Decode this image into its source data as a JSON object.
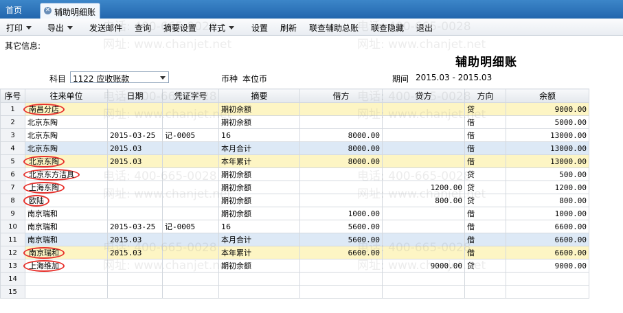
{
  "tabs": {
    "home": "首页",
    "active": "辅助明细账"
  },
  "toolbar": {
    "items": [
      "打印",
      "导出",
      "发送邮件",
      "查询",
      "摘要设置",
      "样式",
      "设置",
      "刷新",
      "联查辅助总账",
      "联查隐藏",
      "退出"
    ]
  },
  "header": {
    "other_info": "其它信息:",
    "title": "辅助明细账",
    "subject_label": "科目",
    "subject_value": "1122 应收账款",
    "currency_label": "币种",
    "currency_value": "本位币",
    "period_label": "期间",
    "period_value": "2015.03 - 2015.03"
  },
  "watermark": {
    "phone": "电话: 400-665-0028",
    "site": "网址: www.chanjet.net"
  },
  "table": {
    "columns": [
      "序号",
      "往来单位",
      "日期",
      "凭证字号",
      "摘要",
      "借方",
      "贷方",
      "方向",
      "余额"
    ],
    "rows": [
      {
        "no": "1",
        "unit": "南昌分店",
        "date": "",
        "voucher": "",
        "summary": "期初余额",
        "debit": "",
        "credit": "",
        "dir": "贷",
        "balance": "9000.00",
        "style": "yellow",
        "circled": true
      },
      {
        "no": "2",
        "unit": "北京东陶",
        "date": "",
        "voucher": "",
        "summary": "期初余额",
        "debit": "",
        "credit": "",
        "dir": "借",
        "balance": "5000.00",
        "style": "",
        "circled": false
      },
      {
        "no": "3",
        "unit": "北京东陶",
        "date": "2015-03-25",
        "voucher": "记-0005",
        "summary": "16",
        "debit": "8000.00",
        "credit": "",
        "dir": "借",
        "balance": "13000.00",
        "style": "",
        "circled": false
      },
      {
        "no": "4",
        "unit": "北京东陶",
        "date": "2015.03",
        "voucher": "",
        "summary": "本月合计",
        "debit": "8000.00",
        "credit": "",
        "dir": "借",
        "balance": "13000.00",
        "style": "blue",
        "circled": false
      },
      {
        "no": "5",
        "unit": "北京东陶",
        "date": "2015.03",
        "voucher": "",
        "summary": "本年累计",
        "debit": "8000.00",
        "credit": "",
        "dir": "借",
        "balance": "13000.00",
        "style": "yellow",
        "circled": true
      },
      {
        "no": "6",
        "unit": "北京东方洁具",
        "date": "",
        "voucher": "",
        "summary": "期初余额",
        "debit": "",
        "credit": "",
        "dir": "贷",
        "balance": "500.00",
        "style": "",
        "circled": true
      },
      {
        "no": "7",
        "unit": "上海东陶",
        "date": "",
        "voucher": "",
        "summary": "期初余额",
        "debit": "",
        "credit": "1200.00",
        "dir": "贷",
        "balance": "1200.00",
        "style": "",
        "circled": true
      },
      {
        "no": "8",
        "unit": "欧陆",
        "date": "",
        "voucher": "",
        "summary": "期初余额",
        "debit": "",
        "credit": "800.00",
        "dir": "贷",
        "balance": "800.00",
        "style": "",
        "circled": true
      },
      {
        "no": "9",
        "unit": "南京瑞和",
        "date": "",
        "voucher": "",
        "summary": "期初余额",
        "debit": "1000.00",
        "credit": "",
        "dir": "借",
        "balance": "1000.00",
        "style": "",
        "circled": false
      },
      {
        "no": "10",
        "unit": "南京瑞和",
        "date": "2015-03-25",
        "voucher": "记-0005",
        "summary": "16",
        "debit": "5600.00",
        "credit": "",
        "dir": "借",
        "balance": "6600.00",
        "style": "",
        "circled": false
      },
      {
        "no": "11",
        "unit": "南京瑞和",
        "date": "2015.03",
        "voucher": "",
        "summary": "本月合计",
        "debit": "5600.00",
        "credit": "",
        "dir": "借",
        "balance": "6600.00",
        "style": "blue",
        "circled": false
      },
      {
        "no": "12",
        "unit": "南京瑞和",
        "date": "2015.03",
        "voucher": "",
        "summary": "本年累计",
        "debit": "6600.00",
        "credit": "",
        "dir": "借",
        "balance": "6600.00",
        "style": "yellow",
        "circled": true
      },
      {
        "no": "13",
        "unit": "上海维加",
        "date": "",
        "voucher": "",
        "summary": "期初余额",
        "debit": "",
        "credit": "9000.00",
        "dir": "贷",
        "balance": "9000.00",
        "style": "",
        "circled": true
      },
      {
        "no": "14",
        "unit": "",
        "date": "",
        "voucher": "",
        "summary": "",
        "debit": "",
        "credit": "",
        "dir": "",
        "balance": "",
        "style": "",
        "circled": false
      },
      {
        "no": "15",
        "unit": "",
        "date": "",
        "voucher": "",
        "summary": "",
        "debit": "",
        "credit": "",
        "dir": "",
        "balance": "",
        "style": "",
        "circled": false
      }
    ]
  }
}
